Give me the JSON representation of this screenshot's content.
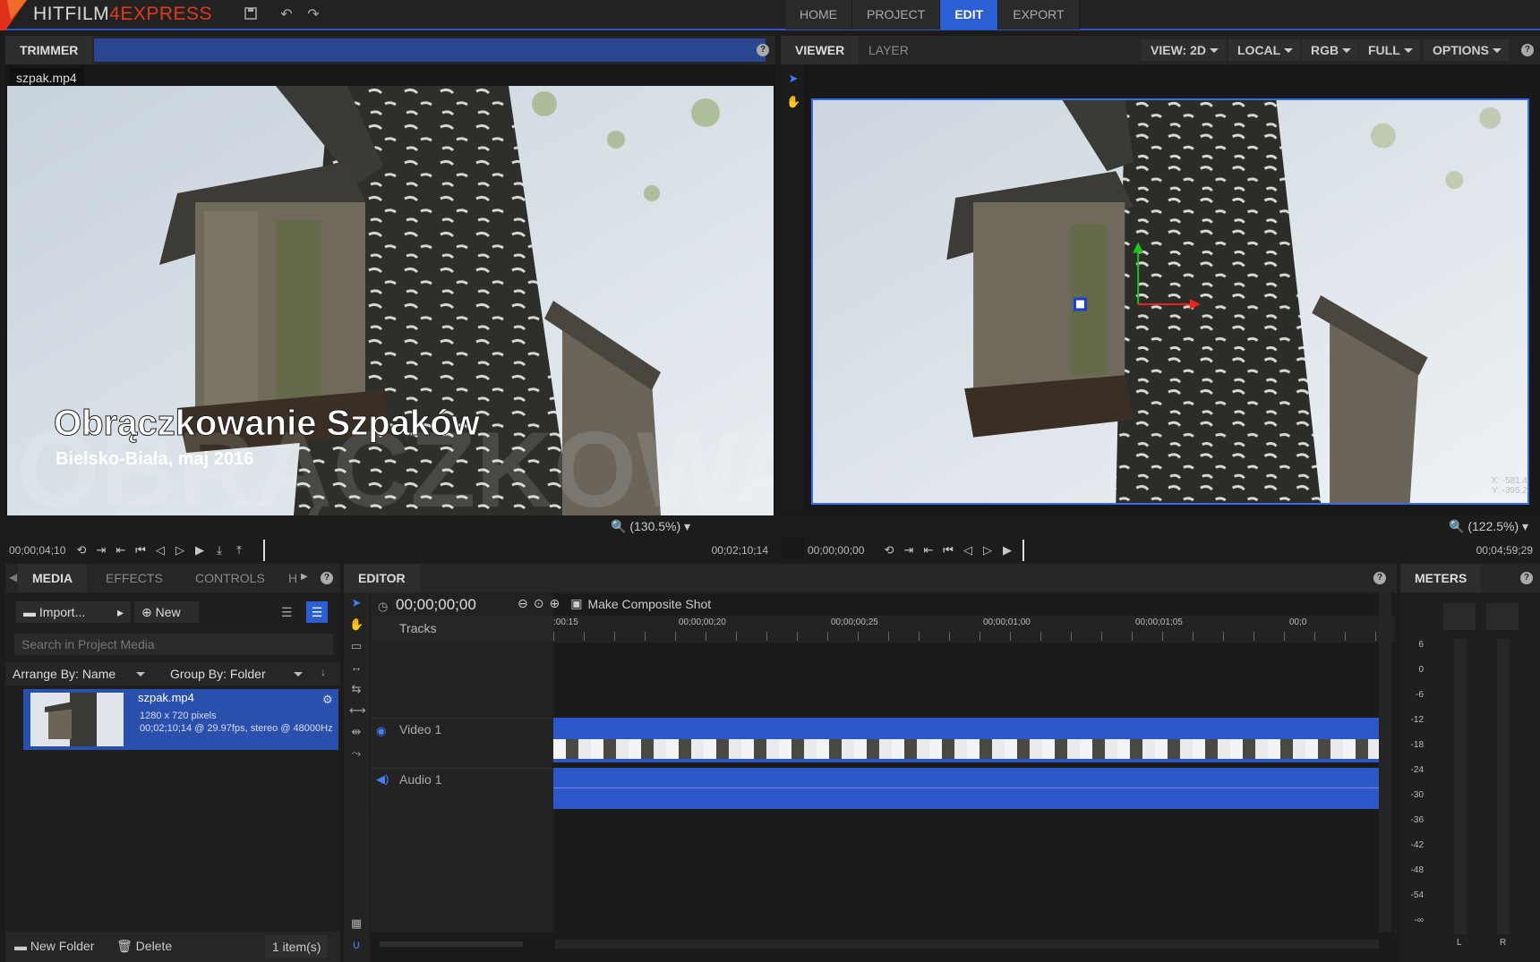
{
  "app": {
    "logo_part1": "HITFILM",
    "logo_part2": "4",
    "logo_part3": "EXPRESS",
    "nav": [
      "HOME",
      "PROJECT",
      "EDIT",
      "EXPORT"
    ],
    "nav_active": "EDIT",
    "accent": "#2c5fd4"
  },
  "trimmer": {
    "tab": "TRIMMER",
    "file": "szpak.mp4",
    "title_overlay": "Obrączkowanie Szpaków",
    "subtitle_overlay": "Bielsko-Biała, maj 2016",
    "bg_text": "OBRĄCZKOWANIE SZPAKÓW",
    "zoom": "(130.5%)",
    "timecode_left": "00;00;04;10",
    "timecode_right": "00;02;10;14"
  },
  "viewer": {
    "tabs": [
      "VIEWER",
      "LAYER"
    ],
    "view": "VIEW: 2D",
    "space": "LOCAL",
    "channel": "RGB",
    "quality": "FULL",
    "options": "OPTIONS",
    "zoom": "(122.5%)",
    "coord_x_label": "X:",
    "coord_x": "-581.4",
    "coord_y_label": "Y:",
    "coord_y": "-395.2",
    "timecode_left": "00;00;00;00",
    "timecode_right": "00;04;59;29"
  },
  "media": {
    "tabs": [
      "MEDIA",
      "EFFECTS",
      "CONTROLS",
      "H"
    ],
    "import_label": "Import...",
    "new_label": "New",
    "search_placeholder": "Search in Project Media",
    "arrange_label": "Arrange By: Name",
    "group_label": "Group By: Folder",
    "item_name": "szpak.mp4",
    "item_res": "1280 x 720 pixels",
    "item_info": "00;02;10;14 @ 29.97fps, stereo @ 48000Hz",
    "new_folder": "New Folder",
    "delete": "Delete",
    "count": "1 item(s)"
  },
  "editor": {
    "tab": "EDITOR",
    "timecode": "00;00;00;00",
    "composite_label": "Make Composite Shot",
    "tracks_label": "Tracks",
    "ruler": [
      ":00:15",
      "00;00;00;20",
      "00;00;00;25",
      "00;00;01;00",
      "00;00;01;05",
      "00;0"
    ],
    "video_track": "Video 1",
    "audio_track": "Audio 1"
  },
  "meters": {
    "tab": "METERS",
    "scale": [
      "6",
      "0",
      "-6",
      "-12",
      "-18",
      "-24",
      "-30",
      "-36",
      "-42",
      "-48",
      "-54",
      "-∞"
    ],
    "left": "L",
    "right": "R"
  }
}
